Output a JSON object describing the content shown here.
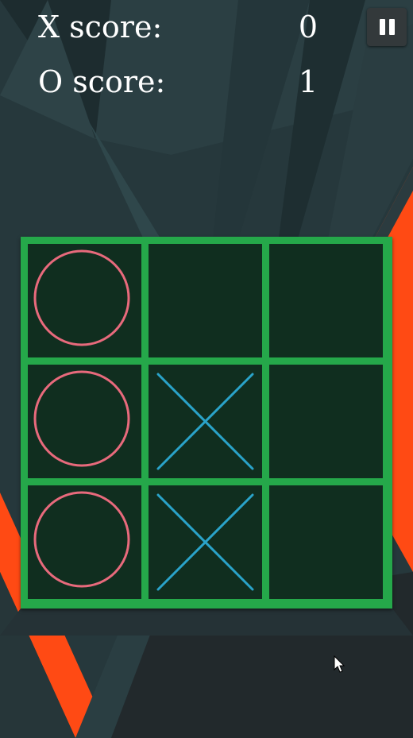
{
  "scoreboard": {
    "x_label": "X score:",
    "x_value": "0",
    "o_label": "O score:",
    "o_value": "1"
  },
  "controls": {
    "pause_icon": "pause-icon"
  },
  "board": {
    "rows": 3,
    "cols": 3,
    "cells": [
      "O",
      "",
      "",
      "O",
      "X",
      "",
      "O",
      "X",
      ""
    ]
  },
  "colors": {
    "grid": "#25a84a",
    "o_mark": "#e86a7c",
    "x_mark": "#2aa3c9",
    "accent": "#ff4a14",
    "background": "#26383c"
  }
}
